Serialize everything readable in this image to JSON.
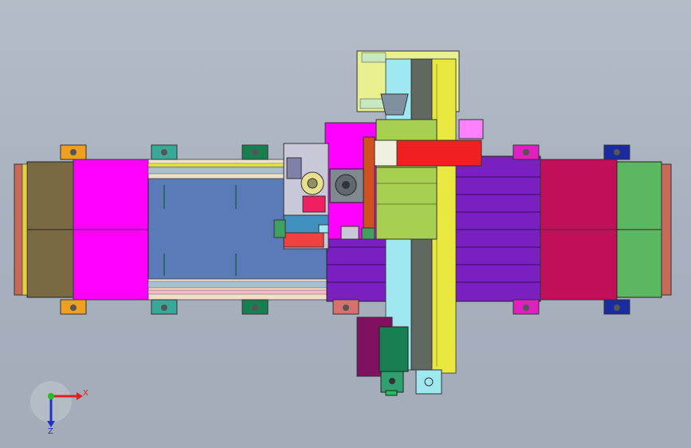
{
  "viewport": {
    "background_top": "#b4bcc8",
    "background_bottom": "#a3acb9"
  },
  "triad": {
    "x_label": "X",
    "z_label": "Z",
    "x_color": "#e02020",
    "y_color": "#20c020",
    "z_color": "#2030d0"
  },
  "model": {
    "colors": {
      "magenta": "#ff00ff",
      "olive_brown": "#7a6a44",
      "crimson": "#c0105a",
      "green": "#5cb860",
      "steel_blue": "#5a7ab8",
      "purple": "#7a20c0",
      "yellow": "#e8e840",
      "light_green": "#c8e890",
      "red": "#f02020",
      "dark_green": "#188050",
      "teal": "#38a898",
      "maroon": "#801060"
    }
  }
}
